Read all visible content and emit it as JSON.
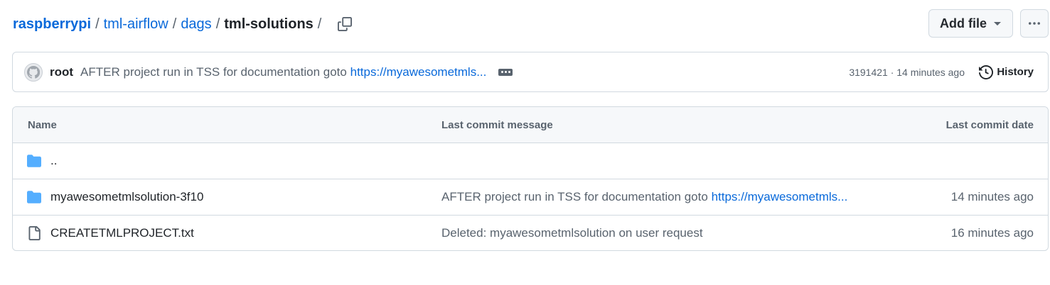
{
  "breadcrumb": {
    "repo": "raspberrypi",
    "path1": "tml-airflow",
    "path2": "dags",
    "current": "tml-solutions",
    "sep": "/"
  },
  "toolbar": {
    "add_file_label": "Add file"
  },
  "latest_commit": {
    "author": "root",
    "message": "AFTER project run in TSS for documentation goto",
    "link": "https://myawesometmls...",
    "meta": "3191421 · 14 minutes ago",
    "history_label": "History"
  },
  "table": {
    "headers": {
      "name": "Name",
      "message": "Last commit message",
      "date": "Last commit date"
    },
    "parent_label": "..",
    "rows": [
      {
        "type": "folder",
        "name": "myawesometmlsolution-3f10",
        "message": "AFTER project run in TSS for documentation goto",
        "link": "https://myawesometmls...",
        "date": "14 minutes ago"
      },
      {
        "type": "file",
        "name": "CREATETMLPROJECT.txt",
        "message": "Deleted: myawesometmlsolution on user request",
        "link": "",
        "date": "16 minutes ago"
      }
    ]
  },
  "colors": {
    "link": "#0969da",
    "folder": "#54aeff",
    "muted": "#59636e",
    "border": "#d1d9e0"
  },
  "icons": [
    "copy-icon",
    "chevron-down-icon",
    "kebab-icon",
    "avatar-icon",
    "ellipsis-icon",
    "history-icon",
    "folder-icon",
    "file-icon"
  ]
}
